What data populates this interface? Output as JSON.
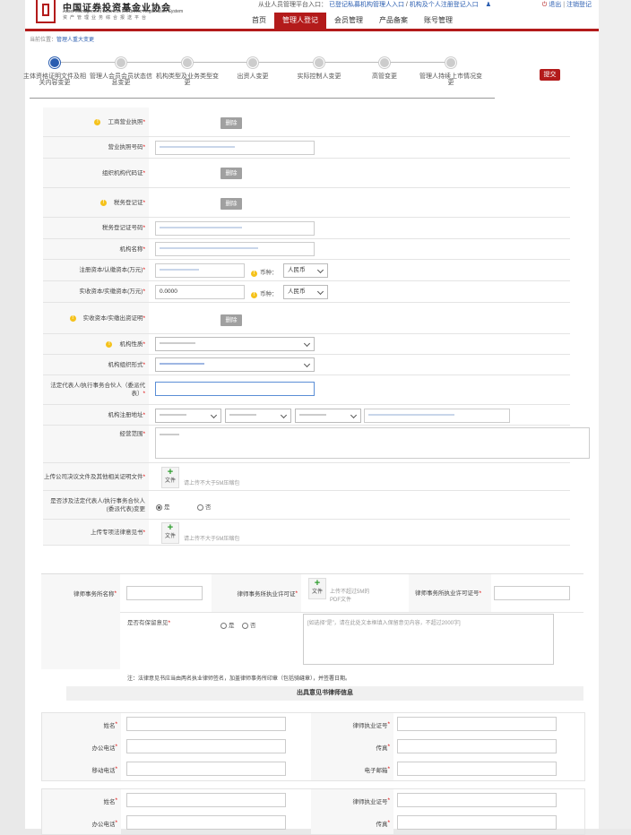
{
  "header": {
    "org_name": "中国证券投资基金业协会",
    "org_name_en": "Asset Management Business Electronic Registration System",
    "org_sub": "资产管理业务综合报送平台",
    "top_links_prefix": "从业人员管理平台入口：",
    "top_link_1": "已登记私募机构管理人入口",
    "top_link_sep": "/",
    "top_link_2": "机构及个人注册登记入口",
    "logout": "退出",
    "sep2": "|",
    "cancel_reg": "注销登记",
    "nav": [
      "首页",
      "管理人登记",
      "会员管理",
      "产品备案",
      "账号管理"
    ],
    "nav_active_index": 1
  },
  "breadcrumb": {
    "prefix": "当前位置：",
    "current": "管理人重大变更"
  },
  "steps": [
    {
      "label": "主体资格证明文件及相关内容变更",
      "done": true
    },
    {
      "label": "管理人会员会员状态信息变更",
      "done": false
    },
    {
      "label": "机构类型及业务类型变更",
      "done": false
    },
    {
      "label": "出资人变更",
      "done": false
    },
    {
      "label": "实际控制人变更",
      "done": false
    },
    {
      "label": "高管变更",
      "done": false
    },
    {
      "label": "管理人持续上市情况变更",
      "done": false
    }
  ],
  "submit_label": "提交",
  "form": {
    "business_license": "工商营业执照",
    "delete": "删除",
    "license_no": "营业执照号码",
    "org_code_cert": "组织机构代码证",
    "tax_cert": "税务登记证",
    "tax_cert_no": "税务登记证号码",
    "org_name": "机构名称",
    "reg_capital": "注册资本/认缴资本(万元)",
    "paid_capital": "实收资本/实缴资本(万元)",
    "paid_capital_value": "0.0000",
    "currency_label": "币种：",
    "currency_value": "人民币",
    "paid_capital_proof": "实收资本/实缴出资证明",
    "org_nature": "机构性质",
    "org_form": "机构组织形式",
    "legal_rep": "法定代表人/执行事务合伙人（委派代表）",
    "reg_address": "机构注册地址",
    "business_scope": "经营范围",
    "upload_resolution": "上传公司决议文件及其他相关证明文件",
    "file_label": "文件",
    "upload_hint": "请上传不大于5M压缩包",
    "legal_rep_change": "是否涉及法定代表人/执行事务合伙人(委派代表)变更",
    "yes": "是",
    "no": "否",
    "upload_legal_opinion": "上传专项法律意见书"
  },
  "lawyer": {
    "firm_name": "律师事务所名称",
    "firm_license": "律师事务所执业许可证",
    "firm_license_hint": "上传不超过5M的PDF文件",
    "firm_license_no": "律师事务所执业许可证号",
    "reserved_opinion": "是否有保留意见",
    "reserved_placeholder": "[如选择“是”，请在此处文本框填入保留意见内容，不超过2000字]",
    "note": "注：法律意见书应当由两名执业律师签名，加盖律师事务所印章（包括骑缝章），并签署日期。",
    "section_title": "出具意见书律师信息",
    "name": "姓名",
    "lawyer_license_no": "律师执业证号",
    "office_phone": "办公电话",
    "fax": "传真",
    "mobile": "移动电话",
    "email": "电子邮箱"
  },
  "colors": {
    "brand": "#b31b1b",
    "link": "#2a5db0",
    "warn": "#f5c21b"
  },
  "icons": {
    "warn": "exclamation-circle-icon",
    "add": "plus-icon",
    "chevron": "chevron-down-icon",
    "user": "user-icon",
    "power": "power-icon"
  }
}
